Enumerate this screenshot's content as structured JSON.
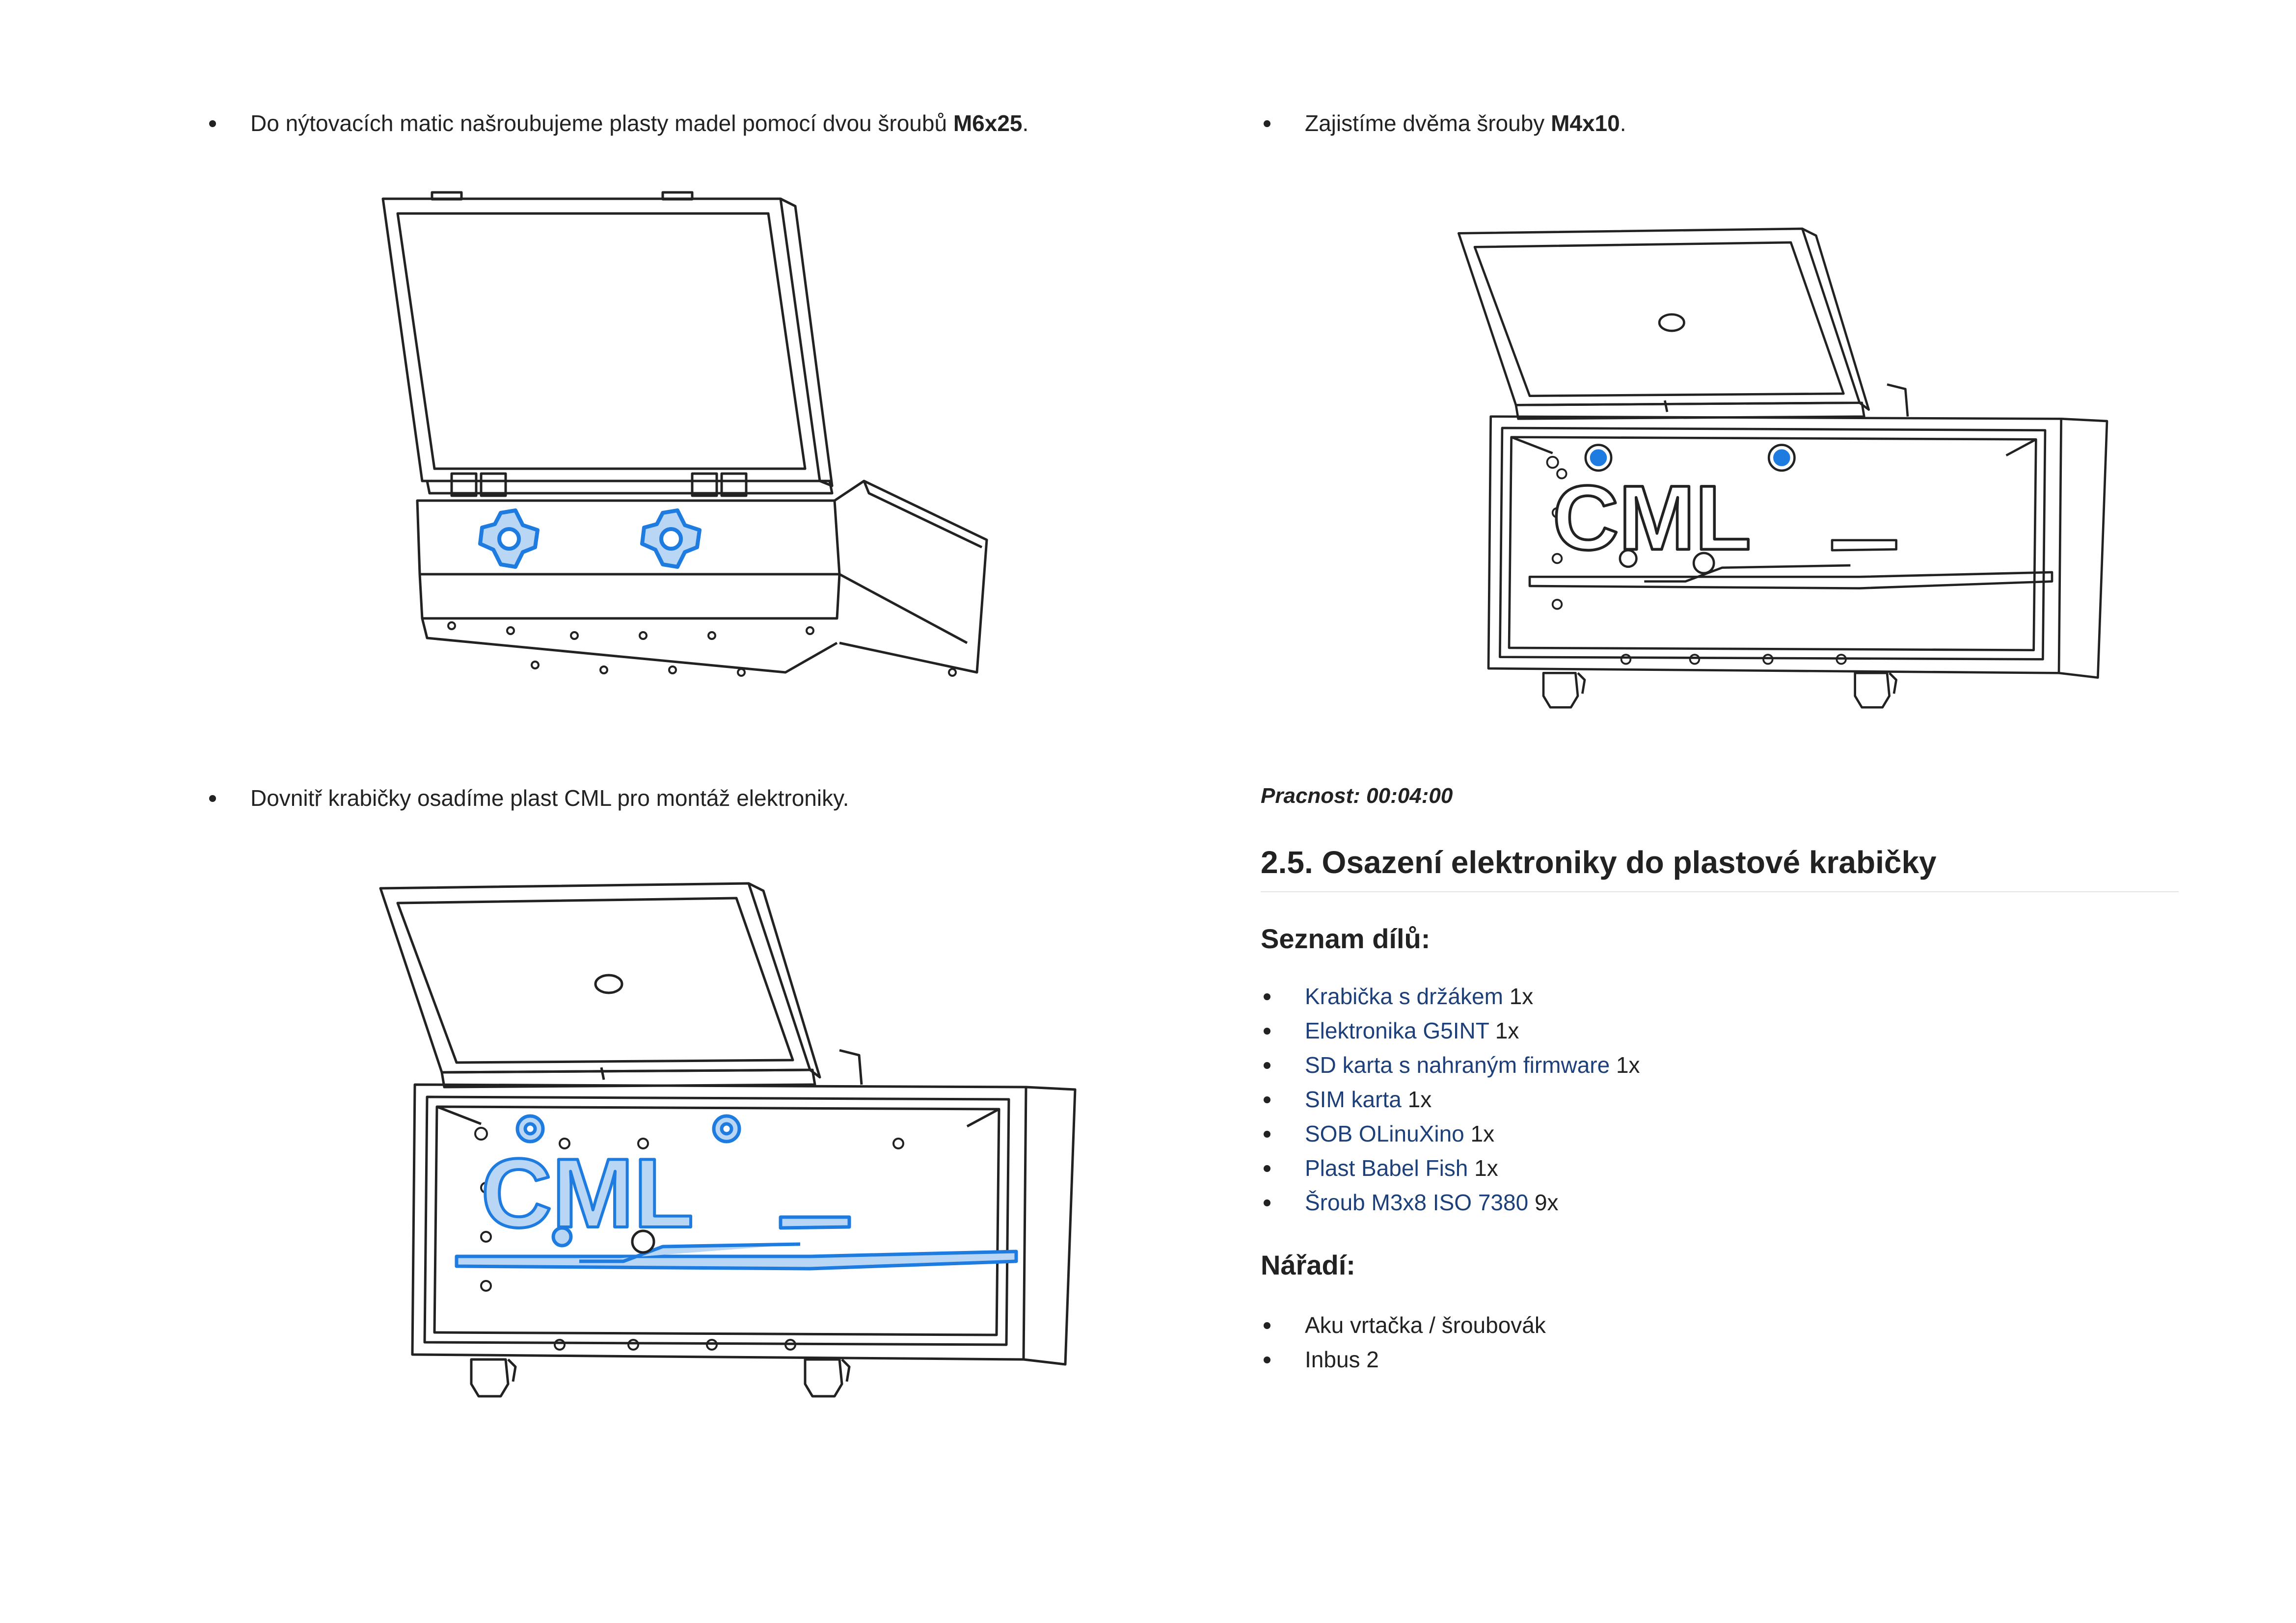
{
  "steps": {
    "step1": {
      "text_before": "Do nýtovacích matic našroubujeme plasty madel pomocí dvou šroubů ",
      "bold": "M6x25",
      "text_after": "."
    },
    "step2": {
      "text": "Dovnitř krabičky osadíme plast CML pro montáž elektroniky."
    },
    "step3": {
      "text_before": "Zajistíme dvěma šrouby ",
      "bold": "M4x10",
      "text_after": "."
    }
  },
  "figures": {
    "logo_text": "CML",
    "line_color": "#222222",
    "highlight_color": "#1e7be0",
    "highlight_fill": "#b9d6f5"
  },
  "labor": "Pracnost: 00:04:00",
  "section": {
    "title": "2.5. Osazení elektroniky do plastové krabičky",
    "parts_heading": "Seznam dílů:",
    "parts": [
      {
        "name": "Krabička s držákem",
        "qty": "1x"
      },
      {
        "name": "Elektronika G5INT",
        "qty": "1x"
      },
      {
        "name": "SD karta s nahraným firmware",
        "qty": "1x"
      },
      {
        "name": "SIM karta",
        "qty": "1x"
      },
      {
        "name": "SOB OLinuXino",
        "qty": "1x"
      },
      {
        "name": "Plast Babel Fish",
        "qty": "1x"
      },
      {
        "name": "Šroub M3x8 ISO 7380",
        "qty": "9x"
      }
    ],
    "tools_heading": "Nářadí:",
    "tools": [
      "Aku vrtačka / šroubovák",
      "Inbus 2"
    ]
  }
}
